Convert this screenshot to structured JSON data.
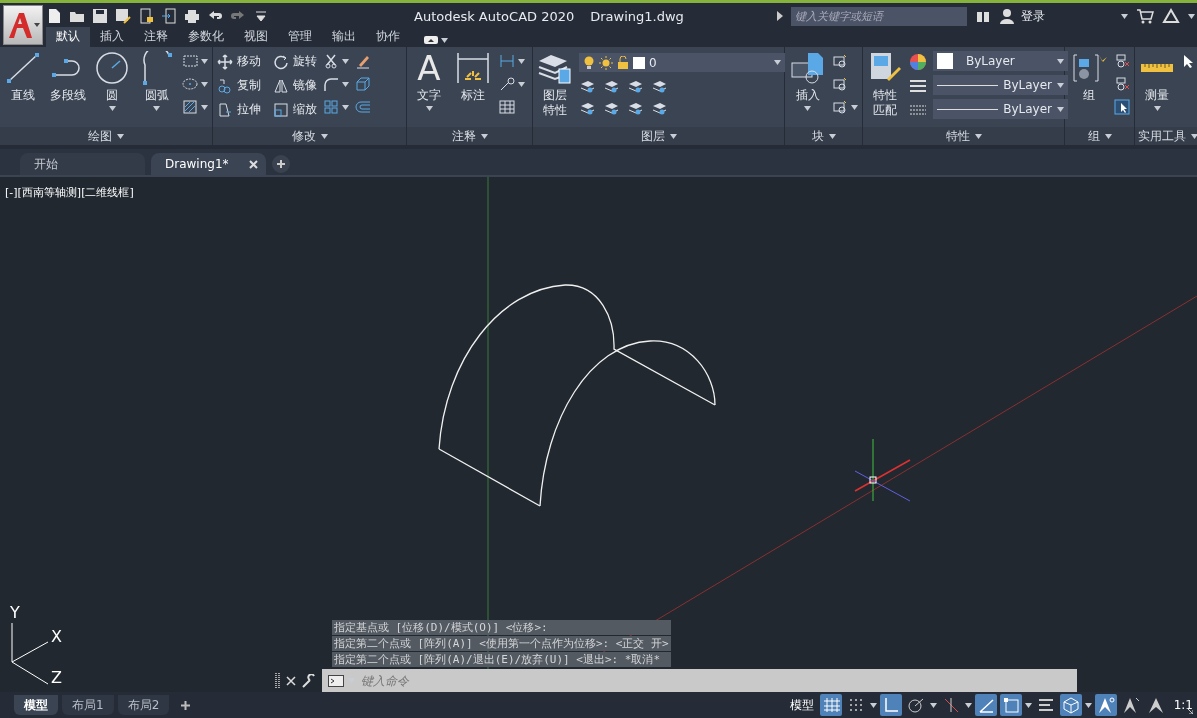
{
  "title_bar": {
    "app": "Autodesk AutoCAD 2020",
    "document": "Drawing1.dwg",
    "search": {
      "placeholder": "键入关键字或短语"
    },
    "sign_in": "登录"
  },
  "ribbon_tabs": [
    {
      "label": "默认",
      "selected": true
    },
    {
      "label": "插入",
      "selected": false
    },
    {
      "label": "注释",
      "selected": false
    },
    {
      "label": "参数化",
      "selected": false
    },
    {
      "label": "视图",
      "selected": false
    },
    {
      "label": "管理",
      "selected": false
    },
    {
      "label": "输出",
      "selected": false
    },
    {
      "label": "协作",
      "selected": false
    }
  ],
  "ribbon_panels": [
    {
      "kind": "draw",
      "title": "绘图",
      "large_tools": [
        {
          "label_lines": [
            "直线"
          ],
          "menu": false
        },
        {
          "label_lines": [
            "多段线"
          ],
          "menu": false
        },
        {
          "label_lines": [
            "圆"
          ],
          "menu": true
        },
        {
          "label_lines": [
            "圆弧"
          ],
          "menu": true
        }
      ]
    },
    {
      "kind": "modify",
      "title": "修改",
      "small_tools": [
        {
          "label": "移动"
        },
        {
          "label": "旋转"
        },
        {
          "label": "复制"
        },
        {
          "label": "镜像"
        },
        {
          "label": "拉伸"
        },
        {
          "label": "缩放"
        }
      ]
    },
    {
      "kind": "annotate",
      "title": "注释",
      "text_glyph": "A",
      "large_tools": [
        {
          "label_lines": [
            "文字"
          ],
          "menu": true
        },
        {
          "label_lines": [
            "标注"
          ],
          "menu": false
        }
      ]
    },
    {
      "kind": "layers",
      "title": "图层",
      "large_tools": [
        {
          "label_lines": [
            "图层",
            "特性"
          ],
          "menu": false
        }
      ],
      "layer": "0"
    },
    {
      "kind": "block",
      "title": "块",
      "large_tools": [
        {
          "label_lines": [
            "插入"
          ],
          "menu": true
        }
      ]
    },
    {
      "kind": "properties",
      "title": "特性",
      "large_tools": [
        {
          "label_lines": [
            "特性",
            "匹配"
          ],
          "menu": false
        }
      ],
      "dropdowns": [
        {
          "kind": "color",
          "value": "ByLayer"
        },
        {
          "kind": "line",
          "value": "ByLayer"
        },
        {
          "kind": "line",
          "value": "ByLayer"
        }
      ]
    },
    {
      "kind": "groups",
      "title": "组",
      "large_tools": [
        {
          "label_lines": [
            "组"
          ],
          "menu": false
        }
      ]
    },
    {
      "kind": "utilities",
      "title": "实用工具",
      "large_tools": [
        {
          "label_lines": [
            "测量"
          ],
          "menu": true
        }
      ]
    }
  ],
  "doc_tabs": [
    {
      "label": "开始",
      "selected": false,
      "closable": false
    },
    {
      "label": "Drawing1*",
      "selected": true,
      "closable": true
    }
  ],
  "viewport": {
    "label": "[-][西南等轴测][二维线框]",
    "ucs_axes": [
      "Y",
      "X",
      "Z"
    ],
    "command_history": [
      "指定基点或 [位移(D)/模式(O)] <位移>:",
      "指定第二个点或 [阵列(A)] <使用第一个点作为位移>: <正交 开>",
      "指定第二个点或 [阵列(A)/退出(E)/放弃(U)] <退出>: *取消*"
    ],
    "command_input": {
      "placeholder": "键入命令"
    }
  },
  "layout_tabs": [
    {
      "label": "模型",
      "selected": true
    },
    {
      "label": "布局1",
      "selected": false
    },
    {
      "label": "布局2",
      "selected": false
    }
  ],
  "status_bar": {
    "space": "模型",
    "scale": "1:1",
    "toggles": [
      {
        "kind": "grid",
        "on": true,
        "menu": false
      },
      {
        "kind": "snap",
        "on": false,
        "menu": true
      },
      {
        "kind": "ortho",
        "on": true,
        "menu": false
      },
      {
        "kind": "polar",
        "on": false,
        "menu": true
      },
      {
        "kind": "isodraft",
        "on": false,
        "menu": true
      },
      {
        "kind": "tracking",
        "on": true,
        "menu": false
      },
      {
        "kind": "osnap",
        "on": true,
        "menu": true
      },
      {
        "kind": "lineweight",
        "on": false,
        "menu": false
      },
      {
        "kind": "osnap3d",
        "on": true,
        "menu": true
      },
      {
        "kind": "annovis",
        "on": true,
        "menu": false
      },
      {
        "kind": "autoscale",
        "on": false,
        "menu": false
      },
      {
        "kind": "annoscale",
        "on": false,
        "menu": false
      }
    ]
  }
}
